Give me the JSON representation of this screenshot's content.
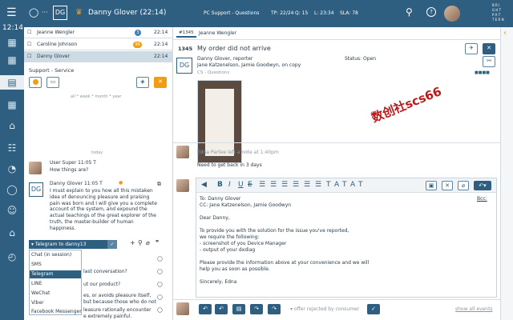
{
  "topbar": {
    "brand_initials": "DG",
    "agent_name": "Danny Glover (22:14)",
    "queue_title": "PC Support - Questions",
    "stats": [
      "TP: 22/24",
      "Q: 15",
      "L: 23:34",
      "SLA: 78"
    ],
    "brand_letters": "B R I\nG H T\nP A T\nT E R N",
    "clock": "12:14"
  },
  "conversations": [
    {
      "name": "Jeanne Wengler",
      "badge": "3",
      "time": "22:14"
    },
    {
      "name": "Caroline Johnson",
      "badge": "99",
      "time": "22:14"
    },
    {
      "name": "Danny Glover",
      "badge": "",
      "time": "22:14"
    }
  ],
  "service": {
    "title": "Support - Service",
    "filter_hint": "all * week * month * year",
    "today_label": "today"
  },
  "chat": {
    "msg1": {
      "author": "User Super 11:05 T",
      "text": "How things are?"
    },
    "msg2": {
      "author": "Danny Glover 11:05 T",
      "text": "I must explain to you how all this mistaken idea of denouncing pleasure and praising pain was born and I will give you a complete account of the system, and expound the actual teachings of the great explorer of the truth, the master-builder of human happiness."
    },
    "channel_label": "Telegram to danny13",
    "channels": [
      "Chat (in session)",
      "SMS",
      "Telegram",
      "LINE",
      "WeChat",
      "Viber",
      "Facebook Messenger"
    ],
    "snippets": [
      "last conversation?",
      "ut our product?",
      "es, or avoids pleasure itself,",
      "but because those who do not",
      "leasure rationally encounter",
      "e extremely painful."
    ]
  },
  "case": {
    "tab_id": "#1345",
    "tab_name": "Jeanne Wengler",
    "id": "1345",
    "subject": "My order did not arrive",
    "reporter": "Danny Glover, reporter",
    "status": "Status: Open",
    "cc": "Jane Katzenelson, Jamie Goodwyn, on copy",
    "category": "CS - Questions",
    "note_header": "Edna Partee left a note at 1:40pm",
    "note_text": "Need to get back in 3 days",
    "watermark": "数创社scs66"
  },
  "editor": {
    "to": "To: Danny Glover",
    "cc": "CC: Jane Katzenelson, Jamie Goodwyn",
    "bcc": "Bcc:",
    "body": [
      "Dear Danny,",
      "",
      "To provide you with the solution for the issue you've reported,",
      "we require the following:",
      "- screenshot of you Device Manager",
      "- output of your dxdiag",
      "",
      "Please provide the information above at your convenience and we will",
      "help you as soon as possible.",
      "",
      "Sincerely, Edna"
    ]
  },
  "bottom": {
    "offer_label": "offer rejected by consumer",
    "show_all": "show all events"
  },
  "colors": {
    "primary": "#2e5f80",
    "accent": "#f39c12",
    "badge_blue": "#3f7fb5",
    "watermark": "#c01818"
  }
}
